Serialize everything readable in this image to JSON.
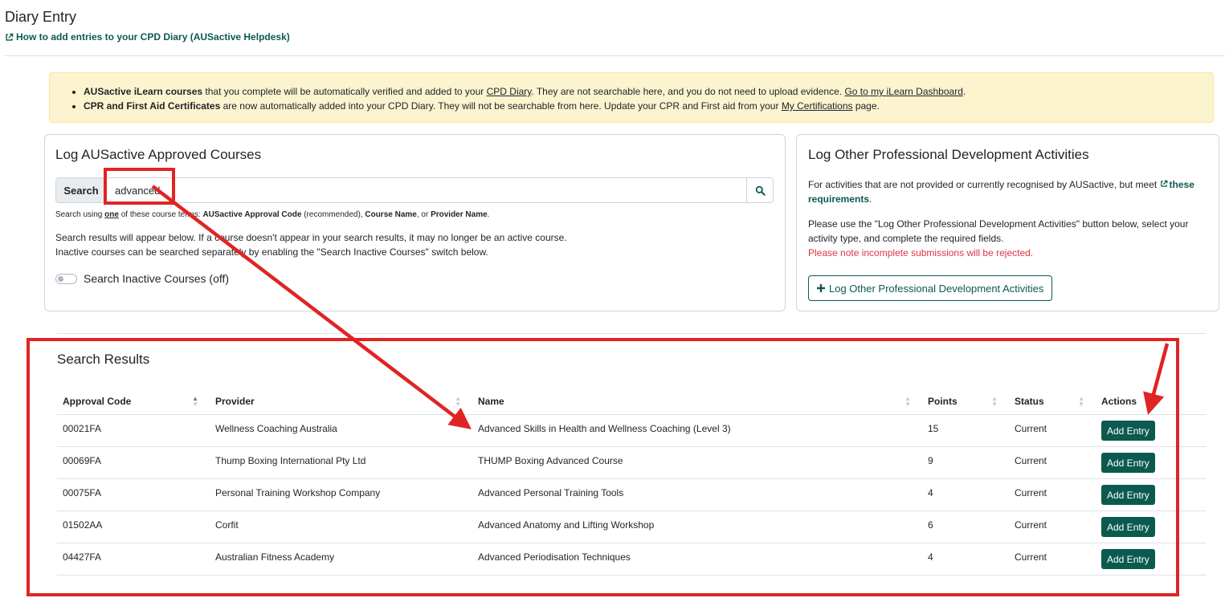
{
  "page": {
    "title": "Diary Entry",
    "help_link": "How to add entries to your CPD Diary (AUSactive Helpdesk)"
  },
  "notice": {
    "item1_bold": "AUSactive iLearn courses",
    "item1_text_a": " that you complete will be automatically verified and added to your ",
    "item1_link1": "CPD Diary",
    "item1_text_b": ". They are not searchable here, and you do not need to upload evidence. ",
    "item1_link2": "Go to my iLearn Dashboard",
    "item1_text_c": ".",
    "item2_bold": "CPR and First Aid Certificates",
    "item2_text_a": " are now automatically added into your CPD Diary. They will not be searchable from here. Update your CPR and First aid from your ",
    "item2_link": "My Certifications",
    "item2_text_b": " page."
  },
  "left_card": {
    "title": "Log AUSactive Approved Courses",
    "search_label": "Search",
    "search_value": "advanced",
    "hint_a": "Search using ",
    "hint_one": "one",
    "hint_b": " of these course terms: ",
    "hint_term1": "AUSactive Approval Code",
    "hint_c": " (recommended), ",
    "hint_term2": "Course Name",
    "hint_d": ", or ",
    "hint_term3": "Provider Name",
    "hint_e": ".",
    "info1": "Search results will appear below. If a course doesn't appear in your search results, it may no longer be an active course.",
    "info2": "Inactive courses can be searched separately by enabling the \"Search Inactive Courses\" switch below.",
    "toggle_label": "Search Inactive Courses (off)"
  },
  "right_card": {
    "title": "Log Other Professional Development Activities",
    "p1_text": "For activities that are not provided or currently recognised by AUSactive, but meet ",
    "p1_link": "these requirements",
    "p1_end": ".",
    "p2_text": "Please use the \"Log Other Professional Development Activities\" button below, select your activity type, and complete the required fields.",
    "p2_warning": "Please note incomplete submissions will be rejected.",
    "button_label": "Log Other Professional Development Activities"
  },
  "results": {
    "title": "Search Results",
    "columns": [
      "Approval Code",
      "Provider",
      "Name",
      "Points",
      "Status",
      "Actions"
    ],
    "action_label": "Add Entry",
    "rows": [
      {
        "code": "00021FA",
        "provider": "Wellness Coaching Australia",
        "name": "Advanced Skills in Health and Wellness Coaching (Level 3)",
        "points": "15",
        "status": "Current"
      },
      {
        "code": "00069FA",
        "provider": "Thump Boxing International Pty Ltd",
        "name": "THUMP Boxing Advanced Course",
        "points": "9",
        "status": "Current"
      },
      {
        "code": "00075FA",
        "provider": "Personal Training Workshop Company",
        "name": "Advanced Personal Training Tools",
        "points": "4",
        "status": "Current"
      },
      {
        "code": "01502AA",
        "provider": "Corfit",
        "name": "Advanced Anatomy and Lifting Workshop",
        "points": "6",
        "status": "Current"
      },
      {
        "code": "04427FA",
        "provider": "Australian Fitness Academy",
        "name": "Advanced Periodisation Techniques",
        "points": "4",
        "status": "Current"
      }
    ]
  },
  "colors": {
    "brand": "#0b5a50",
    "annotation_red": "#e02424",
    "notice_bg": "#fcf3cf",
    "warning_red": "#dc3545"
  }
}
